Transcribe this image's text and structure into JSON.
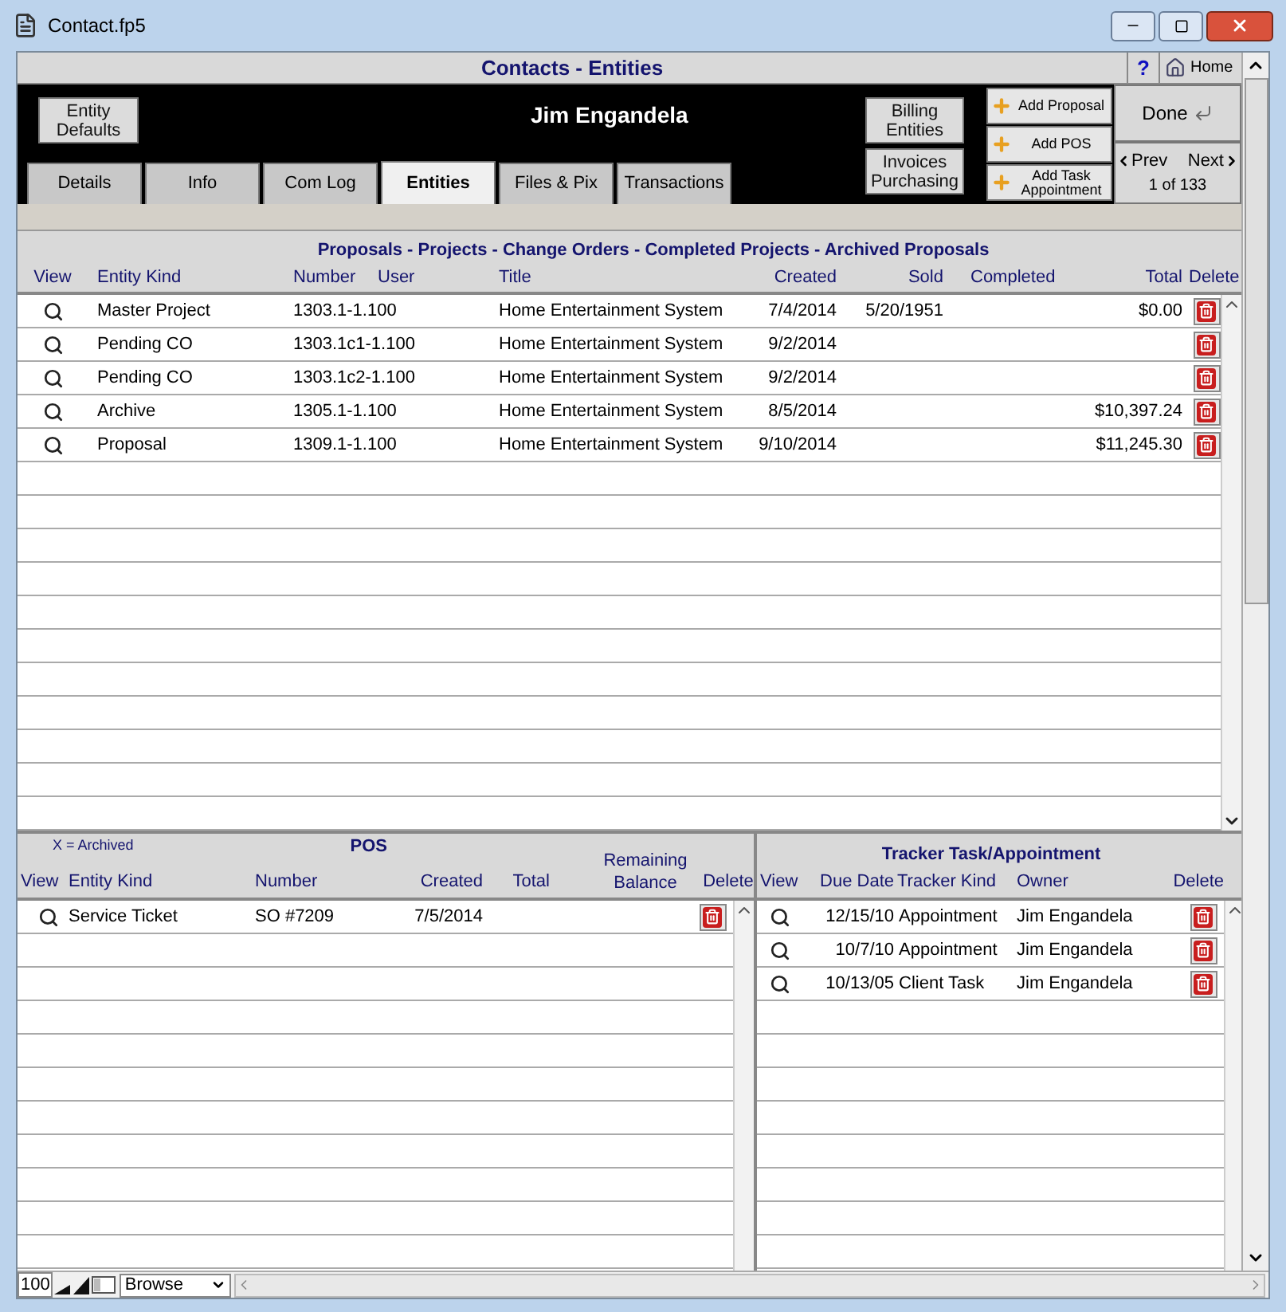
{
  "window": {
    "title": "Contact.fp5"
  },
  "header": {
    "title": "Contacts - Entities",
    "help": "?",
    "home": "Home"
  },
  "contact_name": "Jim Engandela",
  "left_button": "Entity Defaults",
  "entity_buttons": [
    "Billing Entities",
    "Invoices Purchasing"
  ],
  "add_buttons": [
    "Add Proposal",
    "Add POS",
    "Add Task Appointment"
  ],
  "done": "Done",
  "nav": {
    "prev": "Prev",
    "next": "Next",
    "position": "1 of 133"
  },
  "tabs": [
    {
      "label": "Details",
      "selected": false
    },
    {
      "label": "Info",
      "selected": false
    },
    {
      "label": "Com Log",
      "selected": false
    },
    {
      "label": "Entities",
      "selected": true
    },
    {
      "label": "Files & Pix",
      "selected": false
    },
    {
      "label": "Transactions",
      "selected": false
    }
  ],
  "proposals": {
    "title": "Proposals - Projects - Change Orders - Completed Projects - Archived Proposals",
    "columns": [
      "View",
      "Entity Kind",
      "Number",
      "User",
      "Title",
      "Created",
      "Sold",
      "Completed",
      "Total",
      "Delete"
    ],
    "rows": [
      {
        "entity_kind": "Master Project",
        "number": "1303.1-1.100",
        "title": "Home Entertainment System",
        "created": "7/4/2014",
        "sold": "5/20/1951",
        "total": "$0.00"
      },
      {
        "entity_kind": "Pending CO",
        "number": "1303.1c1-1.100",
        "title": "Home Entertainment System",
        "created": "9/2/2014"
      },
      {
        "entity_kind": "Pending CO",
        "number": "1303.1c2-1.100",
        "title": "Home Entertainment System",
        "created": "9/2/2014"
      },
      {
        "entity_kind": "Archive",
        "number": "1305.1-1.100",
        "title": "Home Entertainment System",
        "created": "8/5/2014",
        "total": "$10,397.24"
      },
      {
        "entity_kind": "Proposal",
        "number": "1309.1-1.100",
        "title": "Home Entertainment System",
        "created": "9/10/2014",
        "total": "$11,245.30"
      }
    ]
  },
  "pos": {
    "note": "X = Archived",
    "title": "POS",
    "columns": [
      "View",
      "Entity Kind",
      "Number",
      "Created",
      "Total",
      "Remaining Balance",
      "Delete"
    ],
    "rows": [
      {
        "entity_kind": "Service Ticket",
        "number": "SO #7209",
        "created": "7/5/2014"
      }
    ]
  },
  "tracker": {
    "title": "Tracker Task/Appointment",
    "columns": [
      "View",
      "Due Date",
      "Tracker Kind",
      "Owner",
      "Delete"
    ],
    "rows": [
      {
        "due_date": "12/15/10",
        "tracker_kind": "Appointment",
        "owner": "Jim Engandela"
      },
      {
        "due_date": "10/7/10",
        "tracker_kind": "Appointment",
        "owner": "Jim Engandela"
      },
      {
        "due_date": "10/13/05",
        "tracker_kind": "Client Task",
        "owner": "Jim Engandela"
      }
    ]
  },
  "status_bar": {
    "zoom": "100",
    "mode": "Browse"
  }
}
